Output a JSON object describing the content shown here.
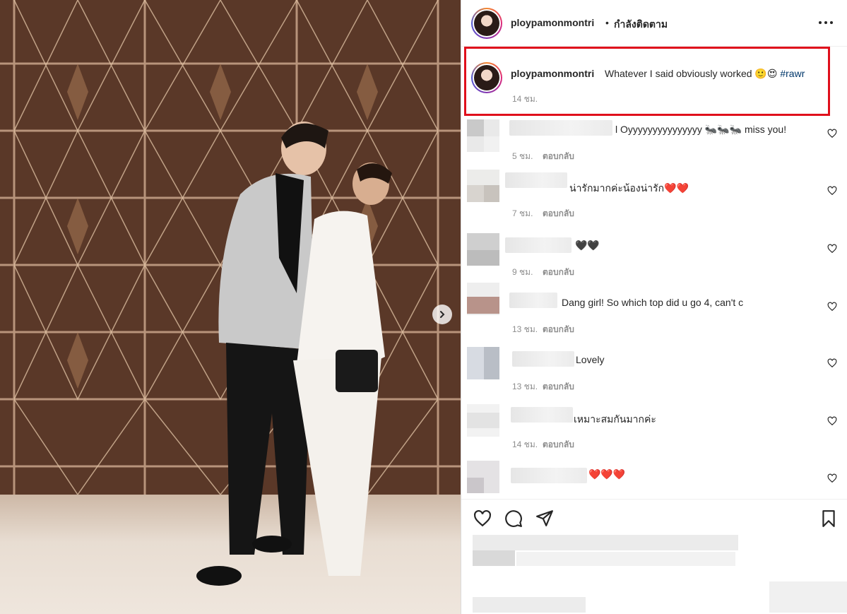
{
  "post": {
    "username": "ploypamonmontri",
    "dot": "•",
    "follow_status": "กำลังติดตาม",
    "more_icon": "more-horizontal-icon",
    "caption": {
      "username": "ploypamonmontri",
      "text": "Whatever I said obviously worked 🙂😍 ",
      "hashtag": "#rawr",
      "time": "14 ชม."
    },
    "highlight_color": "#e0101c"
  },
  "comments": [
    {
      "text": "l Oyyyyyyyyyyyyyyy 🐜🐜🐜 miss you!",
      "time": "5 ชม.",
      "reply": "ตอบกลับ"
    },
    {
      "text": "น่ารักมากค่ะน้องน่ารัก❤️❤️",
      "time": "7 ชม.",
      "reply": "ตอบกลับ"
    },
    {
      "text": "🖤🖤",
      "time": "9 ชม.",
      "reply": "ตอบกลับ"
    },
    {
      "text": "Dang girl! So which top did u go 4, can't c",
      "time": "13 ชม.",
      "reply": "ตอบกลับ"
    },
    {
      "text": "Lovely",
      "time": "13 ชม.",
      "reply": "ตอบกลับ"
    },
    {
      "text": "เหมาะสมกันมากค่ะ",
      "time": "14 ชม.",
      "reply": "ตอบกลับ"
    },
    {
      "text": "❤️❤️❤️",
      "time": "",
      "reply": ""
    }
  ],
  "actions": {
    "like": "heart-icon",
    "comment": "comment-icon",
    "share": "share-icon",
    "save": "bookmark-icon"
  },
  "colors": {
    "text": "#262626",
    "secondary": "#8e8e8e",
    "hashtag": "#00376b"
  }
}
